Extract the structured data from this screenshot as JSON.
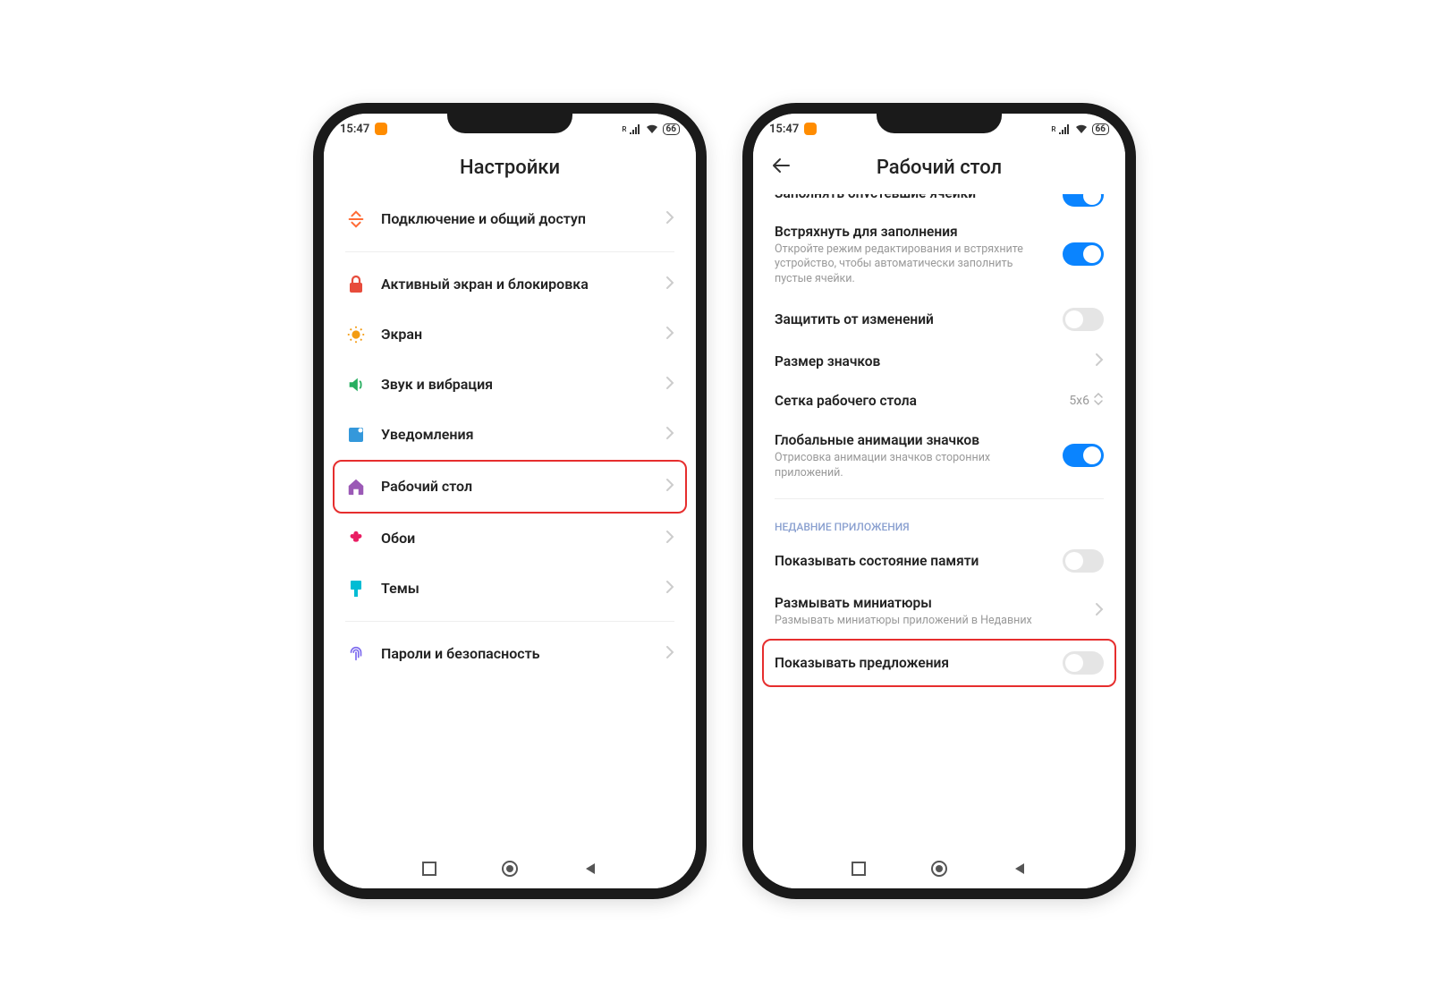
{
  "status": {
    "time": "15:47",
    "signal_label": "R",
    "battery": "66"
  },
  "phone1": {
    "header_title": "Настройки",
    "items": [
      {
        "label": "Подключение и общий доступ",
        "icon": "share",
        "color": "#ff6b35"
      },
      {
        "label": "Активный экран и блокировка",
        "icon": "lock",
        "color": "#e74c3c",
        "divider_before": true
      },
      {
        "label": "Экран",
        "icon": "sun",
        "color": "#f39c12"
      },
      {
        "label": "Звук и вибрация",
        "icon": "speaker",
        "color": "#27ae60"
      },
      {
        "label": "Уведомления",
        "icon": "flag",
        "color": "#3498db"
      },
      {
        "label": "Рабочий стол",
        "icon": "home",
        "color": "#9b59b6",
        "highlight": true
      },
      {
        "label": "Обои",
        "icon": "flower",
        "color": "#e91e63"
      },
      {
        "label": "Темы",
        "icon": "brush",
        "color": "#00bcd4"
      },
      {
        "label": "Пароли и безопасность",
        "icon": "fingerprint",
        "color": "#7b68ee",
        "divider_before": true
      }
    ]
  },
  "phone2": {
    "header_title": "Рабочий стол",
    "cutoff_label": "Заполнять опустевшие ячейки",
    "rows": [
      {
        "title": "Встряхнуть для заполнения",
        "desc": "Откройте режим редактирования и встряхните устройство, чтобы автоматически заполнить пустые ячейки.",
        "control": "toggle-on"
      },
      {
        "title": "Защитить от изменений",
        "control": "toggle-off"
      },
      {
        "title": "Размер значков",
        "control": "chevron"
      },
      {
        "title": "Сетка рабочего стола",
        "control": "value-updown",
        "value": "5x6"
      },
      {
        "title": "Глобальные анимации значков",
        "desc": "Отрисовка анимации значков сторонних приложений.",
        "control": "toggle-on"
      }
    ],
    "section_label": "НЕДАВНИЕ ПРИЛОЖЕНИЯ",
    "recent_rows": [
      {
        "title": "Показывать состояние памяти",
        "control": "toggle-off"
      },
      {
        "title": "Размывать миниатюры",
        "desc": "Размывать миниатюры приложений в Недавних",
        "control": "chevron"
      },
      {
        "title": "Показывать предложения",
        "control": "toggle-off",
        "highlight": true
      }
    ]
  }
}
